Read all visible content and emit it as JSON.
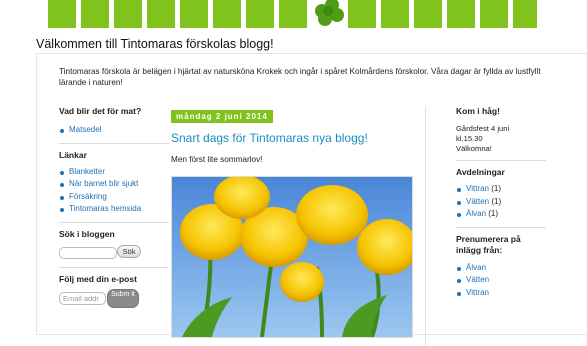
{
  "header": {
    "blog_title": "Välkommen till Tintomaras förskolas blogg!",
    "clover_icon": "four-leaf-clover",
    "accent_color": "#7fc31c"
  },
  "intro": "Tintomaras förskola är belägen i hjärtat av natursköna Krokek och ingår i spåret Kolmårdens förskolor. Våra dagar är fyllda av lustfyllt lärande i naturen!",
  "left": {
    "food_heading": "Vad blir det för mat?",
    "food_items": [
      "Matsedel"
    ],
    "links_heading": "Länkar",
    "links": [
      "Blanketter",
      "När barnet blir sjukt",
      "Försäkring",
      "Tintomaras hemsida"
    ],
    "search_heading": "Sök i bloggen",
    "search_button": "Sök",
    "follow_heading": "Följ med din e-post",
    "email_placeholder": "Email addr",
    "submit_button": "Subm it"
  },
  "post": {
    "date": "måndag 2 juni 2014",
    "title": "Snart dags för Tintomaras nya blogg!",
    "body": "Men först lite sommarlov!",
    "photo": "yellow-tulips-photo"
  },
  "right": {
    "remember_heading": "Kom i håg!",
    "remember_lines": [
      "Gårdsfest 4 juni",
      "kl.15.30",
      "Välkomna!"
    ],
    "divisions_heading": "Avdelningar",
    "divisions": [
      {
        "name": "Vittran",
        "count": "(1)"
      },
      {
        "name": "Vätten",
        "count": "(1)"
      },
      {
        "name": "Älvan",
        "count": "(1)"
      }
    ],
    "subscribe_heading": "Prenumerera på inlägg från:",
    "subscribe_items": [
      "Älvan",
      "Vätten",
      "Vittran"
    ]
  }
}
